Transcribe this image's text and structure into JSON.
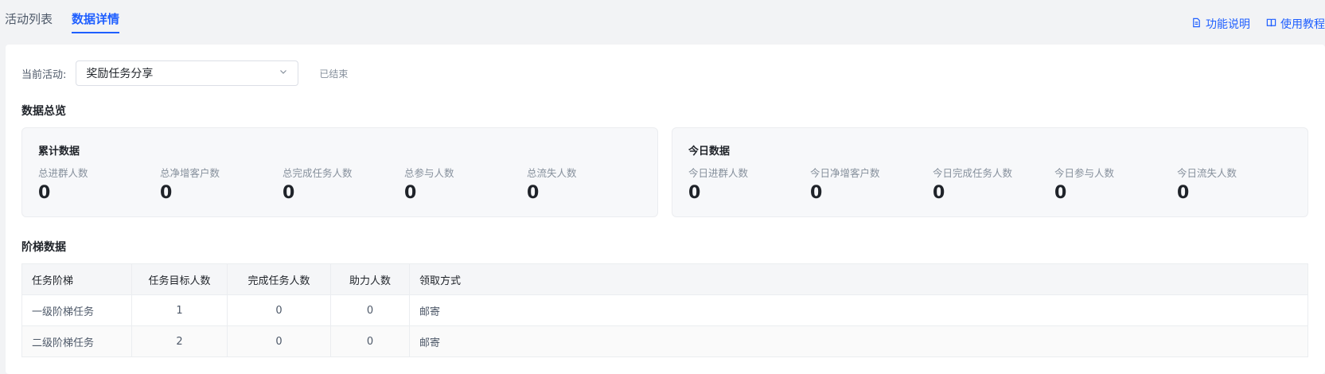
{
  "tabs": [
    {
      "label": "活动列表"
    },
    {
      "label": "数据详情"
    }
  ],
  "top_links": {
    "feature": "功能说明",
    "tutorial": "使用教程"
  },
  "activity": {
    "label": "当前活动:",
    "selected": "奖励任务分享",
    "status": "已结束"
  },
  "overview": {
    "title": "数据总览",
    "cumulative": {
      "title": "累计数据",
      "stats": [
        {
          "label": "总进群人数",
          "value": "0"
        },
        {
          "label": "总净增客户数",
          "value": "0"
        },
        {
          "label": "总完成任务人数",
          "value": "0"
        },
        {
          "label": "总参与人数",
          "value": "0"
        },
        {
          "label": "总流失人数",
          "value": "0"
        }
      ]
    },
    "today": {
      "title": "今日数据",
      "stats": [
        {
          "label": "今日进群人数",
          "value": "0"
        },
        {
          "label": "今日净增客户数",
          "value": "0"
        },
        {
          "label": "今日完成任务人数",
          "value": "0"
        },
        {
          "label": "今日参与人数",
          "value": "0"
        },
        {
          "label": "今日流失人数",
          "value": "0"
        }
      ]
    }
  },
  "ladder": {
    "title": "阶梯数据",
    "columns": [
      "任务阶梯",
      "任务目标人数",
      "完成任务人数",
      "助力人数",
      "领取方式"
    ],
    "rows": [
      [
        "一级阶梯任务",
        "1",
        "0",
        "0",
        "邮寄"
      ],
      [
        "二级阶梯任务",
        "2",
        "0",
        "0",
        "邮寄"
      ]
    ]
  },
  "colors": {
    "accent": "#1f5fff",
    "background": "#f2f3f5"
  }
}
